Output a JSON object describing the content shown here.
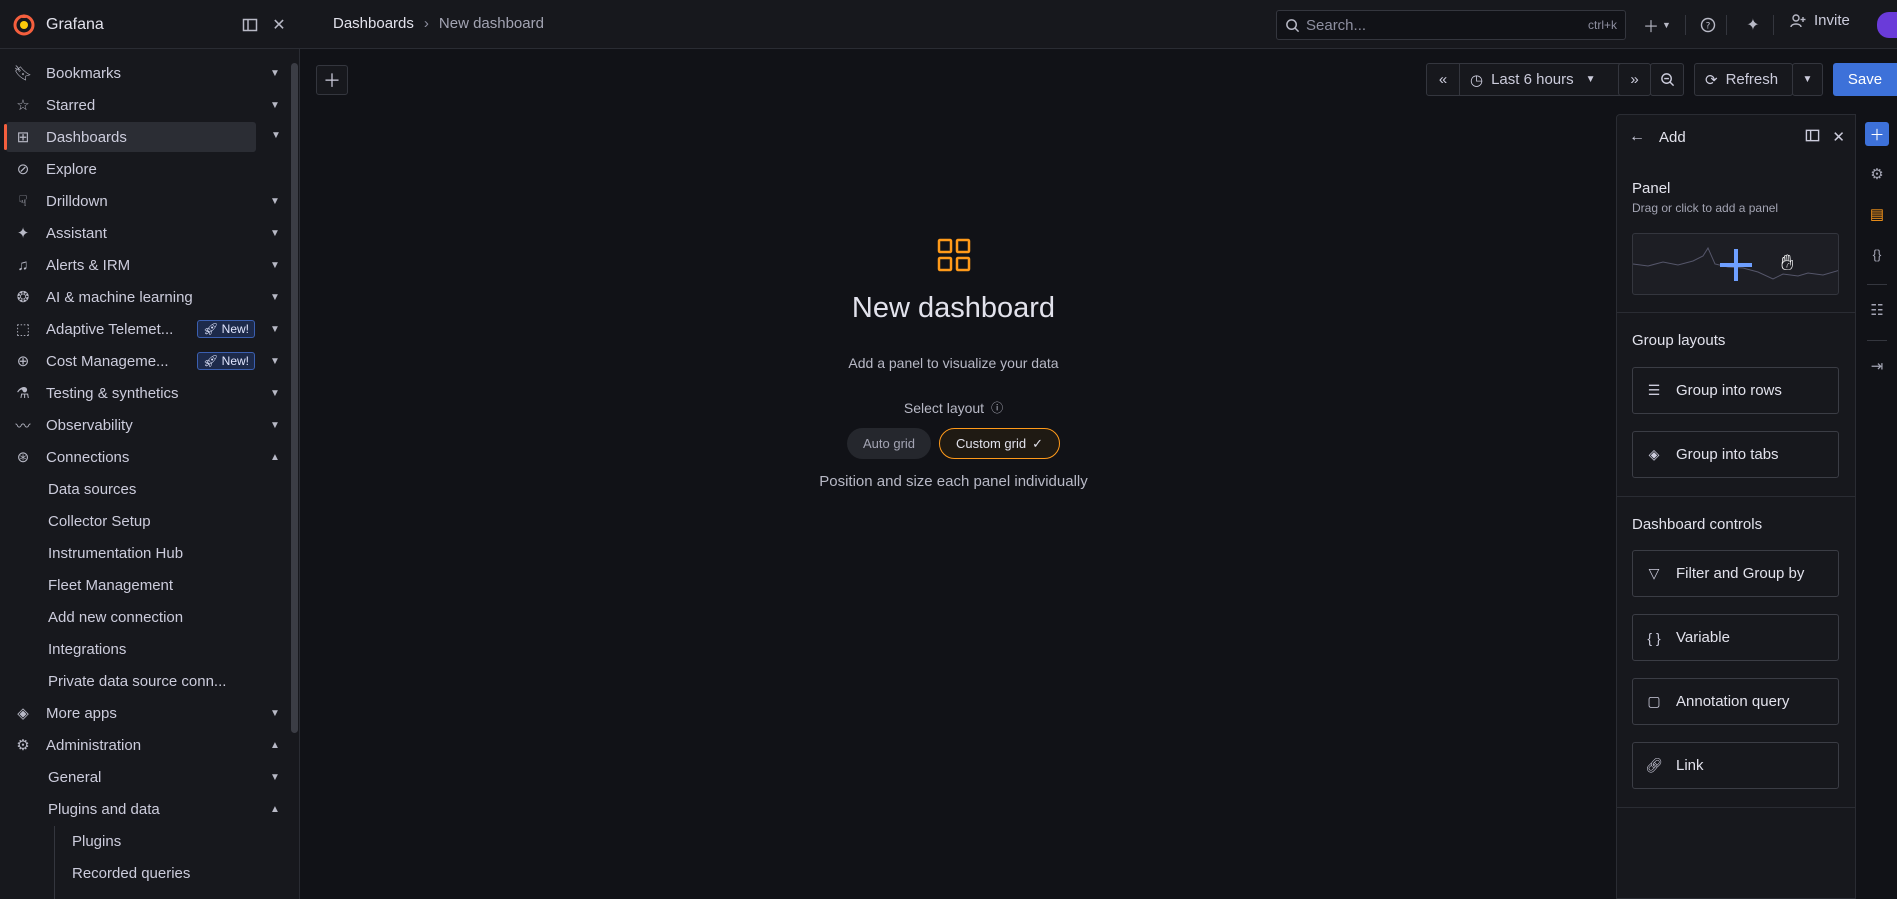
{
  "app": {
    "name": "Grafana"
  },
  "breadcrumb": {
    "root": "Dashboards",
    "separator": "›",
    "current": "New dashboard"
  },
  "search": {
    "placeholder": "Search...",
    "shortcut": "ctrl+k"
  },
  "topbar": {
    "invite_label": "Invite"
  },
  "colors": {
    "brand": "#f55f3e",
    "accent": "#3d71d9",
    "highlight": "#ff9a1a"
  },
  "sidebar": {
    "items": [
      {
        "label": "Bookmarks",
        "icon": "bookmark-icon"
      },
      {
        "label": "Starred",
        "icon": "star-icon"
      },
      {
        "label": "Dashboards",
        "icon": "apps-icon"
      },
      {
        "label": "Explore",
        "icon": "compass-icon"
      },
      {
        "label": "Drilldown",
        "icon": "drilldown-icon"
      },
      {
        "label": "Assistant",
        "icon": "sparkle-icon"
      },
      {
        "label": "Alerts & IRM",
        "icon": "bell-icon"
      },
      {
        "label": "AI & machine learning",
        "icon": "brain-icon"
      },
      {
        "label": "Adaptive Telemet...",
        "icon": "adaptive-icon",
        "badge": "New!"
      },
      {
        "label": "Cost Manageme...",
        "icon": "cost-icon",
        "badge": "New!"
      },
      {
        "label": "Testing & synthetics",
        "icon": "testing-icon"
      },
      {
        "label": "Observability",
        "icon": "pulse-icon"
      },
      {
        "label": "Connections",
        "icon": "link-icon"
      },
      {
        "label": "More apps",
        "icon": "layers-icon"
      },
      {
        "label": "Administration",
        "icon": "gear-icon"
      }
    ],
    "connections_children": [
      "Data sources",
      "Collector Setup",
      "Instrumentation Hub",
      "Fleet Management",
      "Add new connection",
      "Integrations",
      "Private data source conn..."
    ],
    "admin_children": [
      "General",
      "Plugins and data"
    ],
    "plugins_children": [
      "Plugins",
      "Recorded queries"
    ]
  },
  "toolbar": {
    "time_range": "Last 6 hours",
    "refresh_label": "Refresh",
    "save_label": "Save"
  },
  "empty_state": {
    "title": "New dashboard",
    "subtitle": "Add a panel to visualize your data",
    "select_layout": "Select layout",
    "auto_grid": "Auto grid",
    "custom_grid": "Custom grid",
    "position_hint": "Position and size each panel individually"
  },
  "add_panel": {
    "title": "Add",
    "panel_section": "Panel",
    "panel_hint": "Drag or click to add a panel",
    "group_layouts": "Group layouts",
    "group_rows": "Group into rows",
    "group_tabs": "Group into tabs",
    "dashboard_controls": "Dashboard controls",
    "filter_group": "Filter and Group by",
    "variable": "Variable",
    "annotation_query": "Annotation query",
    "link": "Link"
  }
}
